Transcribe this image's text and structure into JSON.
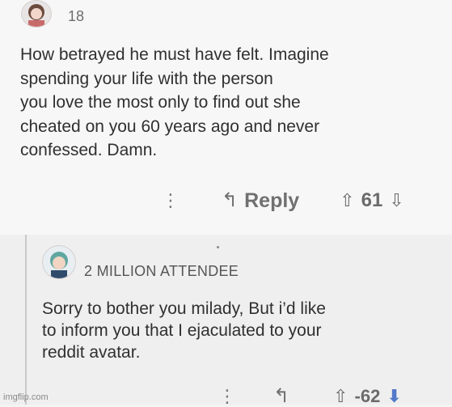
{
  "comments": [
    {
      "meta_count": "18",
      "body": "How betrayed he must have felt. Imagine\nspending your life with the person\nyou love the most only to find out she\ncheated on you 60 years ago and never\nconfessed. Damn.",
      "actions": {
        "more": "⋮",
        "reply_icon": "↰",
        "reply_label": "Reply",
        "up_icon": "⇧",
        "score": "61",
        "down_icon": "⇩"
      }
    },
    {
      "username": "2 MILLION ATTENDEE",
      "body": "Sorry to bother you milady, But i’d like\nto inform you that I ejaculated to your\nreddit avatar.",
      "actions": {
        "more": "⋮",
        "reply_icon": "↰",
        "up_icon": "⇧",
        "score": "-62",
        "down_icon": "⬇"
      }
    }
  ],
  "watermark": "imgflip.com",
  "colors": {
    "downvote_active": "#5479c8"
  }
}
